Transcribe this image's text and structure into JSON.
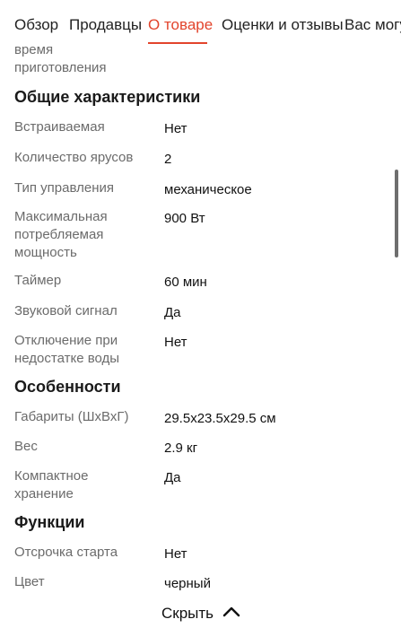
{
  "tabs": [
    {
      "label": "Обзор"
    },
    {
      "label": "Продавцы"
    },
    {
      "label": "О товаре"
    },
    {
      "label": "Оценки и отзывы"
    },
    {
      "label": "Вас могу"
    }
  ],
  "active_tab": "О товаре",
  "accent_color": "#e2442c",
  "cut_label": "время\nприготовления",
  "sections": [
    {
      "title": "Общие характеристики",
      "rows": [
        {
          "label": "Встраиваемая",
          "value": "Нет"
        },
        {
          "label": "Количество ярусов",
          "value": "2"
        },
        {
          "label": "Тип управления",
          "value": "механическое"
        },
        {
          "label": "Максимальная потребляемая мощность",
          "value": "900 Вт"
        },
        {
          "label": "Таймер",
          "value": "60 мин"
        },
        {
          "label": "Звуковой сигнал",
          "value": "Да"
        },
        {
          "label": "Отключение при недостатке воды",
          "value": "Нет"
        }
      ]
    },
    {
      "title": "Особенности",
      "rows": [
        {
          "label": "Габариты (ШхВхГ)",
          "value": "29.5x23.5x29.5 см"
        },
        {
          "label": "Вес",
          "value": "2.9 кг"
        },
        {
          "label": "Компактное хранение",
          "value": "Да"
        }
      ]
    },
    {
      "title": "Функции",
      "rows": [
        {
          "label": "Отсрочка старта",
          "value": "Нет"
        },
        {
          "label": "Цвет",
          "value": "черный"
        }
      ]
    }
  ],
  "hide_button": {
    "label": "Скрыть",
    "icon": "chevron-up-icon"
  }
}
